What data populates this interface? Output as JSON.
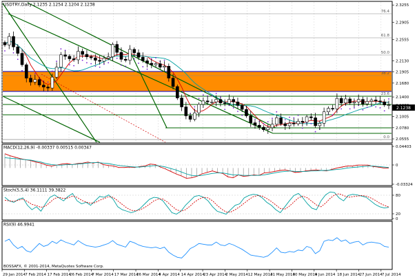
{
  "chart_data": [
    {
      "type": "candlestick",
      "title": "USDTRY,Daily  2.1235 2.1254 2.1204 2.1238",
      "symbol": "USDTRY",
      "timeframe": "Daily",
      "ohlc_header": [
        "2.1235",
        "2.1254",
        "2.1204",
        "2.1238"
      ],
      "x_labels": [
        "29 Jan 2014",
        "7 Feb 2014",
        "17 Feb 2014",
        "26 Feb 2014",
        "7 Mar 2014",
        "17 Mar 2014",
        "26 Mar 2014",
        "4 Apr 2014",
        "14 Apr 2014",
        "23 Apr 2014",
        "2 May 2014",
        "12 May 2014",
        "21 May 2014",
        "30 May 2014",
        "9 Jun 2014",
        "18 Jun 2014",
        "27 Jun 2014",
        "7 Jul 2014"
      ],
      "y_labels": [
        "2.3255",
        "2.2905",
        "2.2555",
        "2.2130",
        "2.1905",
        "2.1680",
        "2.1400",
        "2.1238",
        "2.1005",
        "2.0780",
        "2.0555"
      ],
      "ylim": [
        2.05,
        2.33
      ],
      "current_price": "2.1238",
      "fib_labels": [
        "76.4",
        "61.8",
        "50.0",
        "38.2",
        "23.6",
        "0.0"
      ],
      "closes": [
        2.245,
        2.262,
        2.241,
        2.228,
        2.205,
        2.178,
        2.17,
        2.175,
        2.164,
        2.16,
        2.158,
        2.18,
        2.2,
        2.225,
        2.222,
        2.217,
        2.215,
        2.232,
        2.226,
        2.221,
        2.219,
        2.214,
        2.212,
        2.218,
        2.221,
        2.246,
        2.23,
        2.216,
        2.214,
        2.236,
        2.229,
        2.22,
        2.213,
        2.208,
        2.205,
        2.207,
        2.2,
        2.202,
        2.178,
        2.161,
        2.138,
        2.12,
        2.102,
        2.095,
        2.108,
        2.125,
        2.132,
        2.13,
        2.13,
        2.135,
        2.128,
        2.127,
        2.135,
        2.13,
        2.123,
        2.115,
        2.102,
        2.088,
        2.083,
        2.079,
        2.074,
        2.078,
        2.085,
        2.098,
        2.086,
        2.082,
        2.087,
        2.086,
        2.091,
        2.089,
        2.1,
        2.098,
        2.082,
        2.087,
        2.11,
        2.117,
        2.116,
        2.137,
        2.128,
        2.136,
        2.128,
        2.13,
        2.135,
        2.126,
        2.131,
        2.134,
        2.132,
        2.13,
        2.124,
        2.124
      ]
    },
    {
      "type": "line",
      "title": "MACD(12,26,9) -0.00337 0.00515 0.00347",
      "y_labels": [
        "0.04403",
        "0",
        "-0.03324"
      ],
      "series": [
        {
          "name": "MACD",
          "values": [
            0.029,
            0.025,
            0.022,
            0.019,
            0.017,
            0.015,
            0.012,
            0.01,
            0.006,
            0.004,
            0.006,
            0.008,
            0.009,
            0.007,
            0.009,
            0.01,
            0.012,
            0.01,
            0.012,
            0.007,
            0.005,
            0.004,
            0.001,
            0.001,
            0.002,
            0.001,
            0.003,
            0.004,
            0.008,
            0.007,
            0.002,
            -0.002,
            -0.007,
            -0.012,
            -0.016,
            -0.021,
            -0.02,
            -0.017,
            -0.012,
            -0.009,
            -0.006,
            -0.009,
            -0.011,
            -0.018,
            -0.02,
            -0.014,
            -0.017,
            -0.016,
            -0.014,
            -0.015,
            -0.01,
            -0.009,
            -0.007,
            -0.005,
            -0.004,
            -0.006,
            -0.009,
            -0.008,
            -0.006,
            -0.005,
            -0.004,
            -0.005,
            -0.006,
            -0.003,
            0.0,
            0.002,
            0.004,
            0.004,
            0.006,
            0.006,
            0.006,
            0.003,
            0.002,
            0.0,
            0.0
          ]
        },
        {
          "name": "Signal",
          "values": [
            0.021,
            0.02,
            0.019,
            0.018,
            0.017,
            0.016,
            0.014,
            0.012,
            0.009,
            0.007,
            0.006,
            0.006,
            0.007,
            0.007,
            0.008,
            0.009,
            0.01,
            0.011,
            0.011,
            0.01,
            0.009,
            0.007,
            0.005,
            0.004,
            0.003,
            0.002,
            0.002,
            0.003,
            0.004,
            0.005,
            0.004,
            0.002,
            -0.001,
            -0.004,
            -0.008,
            -0.012,
            -0.015,
            -0.016,
            -0.015,
            -0.013,
            -0.011,
            -0.01,
            -0.01,
            -0.012,
            -0.014,
            -0.014,
            -0.015,
            -0.015,
            -0.015,
            -0.015,
            -0.014,
            -0.012,
            -0.01,
            -0.008,
            -0.007,
            -0.006,
            -0.007,
            -0.007,
            -0.007,
            -0.006,
            -0.006,
            -0.005,
            -0.005,
            -0.004,
            -0.003,
            -0.002,
            0.0,
            0.001,
            0.002,
            0.003,
            0.004,
            0.004,
            0.003,
            0.002,
            0.001
          ]
        }
      ]
    },
    {
      "type": "line",
      "title": "Stoch(5,5,4) 36.1111 39.3822",
      "y_labels": [
        "80",
        "20",
        "0"
      ],
      "ylim": [
        0,
        100
      ],
      "series": [
        {
          "name": "%K",
          "values": [
            72,
            60,
            55,
            65,
            70,
            45,
            30,
            40,
            25,
            50,
            72,
            80,
            70,
            60,
            75,
            85,
            60,
            50,
            55,
            45,
            60,
            75,
            72,
            80,
            65,
            40,
            30,
            25,
            20,
            25,
            35,
            50,
            65,
            72,
            70,
            60,
            40,
            20,
            15,
            25,
            45,
            60,
            75,
            78,
            72,
            60,
            40,
            25,
            20,
            15,
            30,
            45,
            50,
            70,
            78,
            82,
            80,
            70,
            55,
            45,
            30,
            20,
            40,
            60,
            78,
            85,
            70,
            50,
            35,
            30,
            60,
            80,
            90,
            88,
            70,
            60,
            78,
            82,
            80,
            76,
            72,
            60,
            48,
            40,
            36,
            38
          ]
        },
        {
          "name": "%D",
          "values": [
            62,
            60,
            58,
            62,
            66,
            58,
            48,
            44,
            38,
            42,
            55,
            68,
            72,
            68,
            70,
            76,
            72,
            62,
            56,
            52,
            54,
            62,
            68,
            74,
            72,
            60,
            48,
            36,
            28,
            26,
            30,
            38,
            48,
            60,
            66,
            66,
            56,
            42,
            30,
            25,
            30,
            42,
            56,
            66,
            72,
            70,
            60,
            45,
            32,
            22,
            22,
            30,
            40,
            52,
            64,
            74,
            78,
            76,
            68,
            58,
            46,
            34,
            32,
            42,
            56,
            70,
            76,
            70,
            58,
            46,
            40,
            52,
            68,
            80,
            84,
            78,
            72,
            74,
            76,
            78,
            76,
            70,
            62,
            52,
            45,
            39
          ]
        }
      ]
    },
    {
      "type": "line",
      "title": "RSI(9) 46.9941",
      "values": [
        55,
        58,
        50,
        45,
        48,
        42,
        40,
        46,
        52,
        48,
        50,
        55,
        52,
        57,
        54,
        52,
        50,
        56,
        52,
        49,
        48,
        47,
        48,
        50,
        52,
        56,
        51,
        49,
        47,
        55,
        53,
        50,
        48,
        47,
        46,
        47,
        45,
        47,
        40,
        36,
        33,
        32,
        38,
        45,
        48,
        52,
        51,
        50,
        50,
        54,
        50,
        49,
        52,
        50,
        47,
        44,
        40,
        36,
        35,
        34,
        33,
        35,
        40,
        46,
        40,
        39,
        41,
        40,
        43,
        42,
        48,
        46,
        38,
        42,
        55,
        57,
        56,
        60,
        55,
        57,
        52,
        54,
        55,
        50,
        53,
        54,
        53,
        52,
        48,
        47
      ]
    }
  ],
  "copyright": "BOSSAFX, © 2001-2014, MetaQuotes Software Corp.",
  "colors": {
    "up": "#ffffff",
    "down": "#000000",
    "wick": "#000000",
    "ma_fast": "#d40000",
    "ma_slow": "#00a0a0",
    "trend": "#006400",
    "sar": "#7a1fd6",
    "resistance_band": "#ff8c00",
    "grid": "#c8c8c8"
  }
}
